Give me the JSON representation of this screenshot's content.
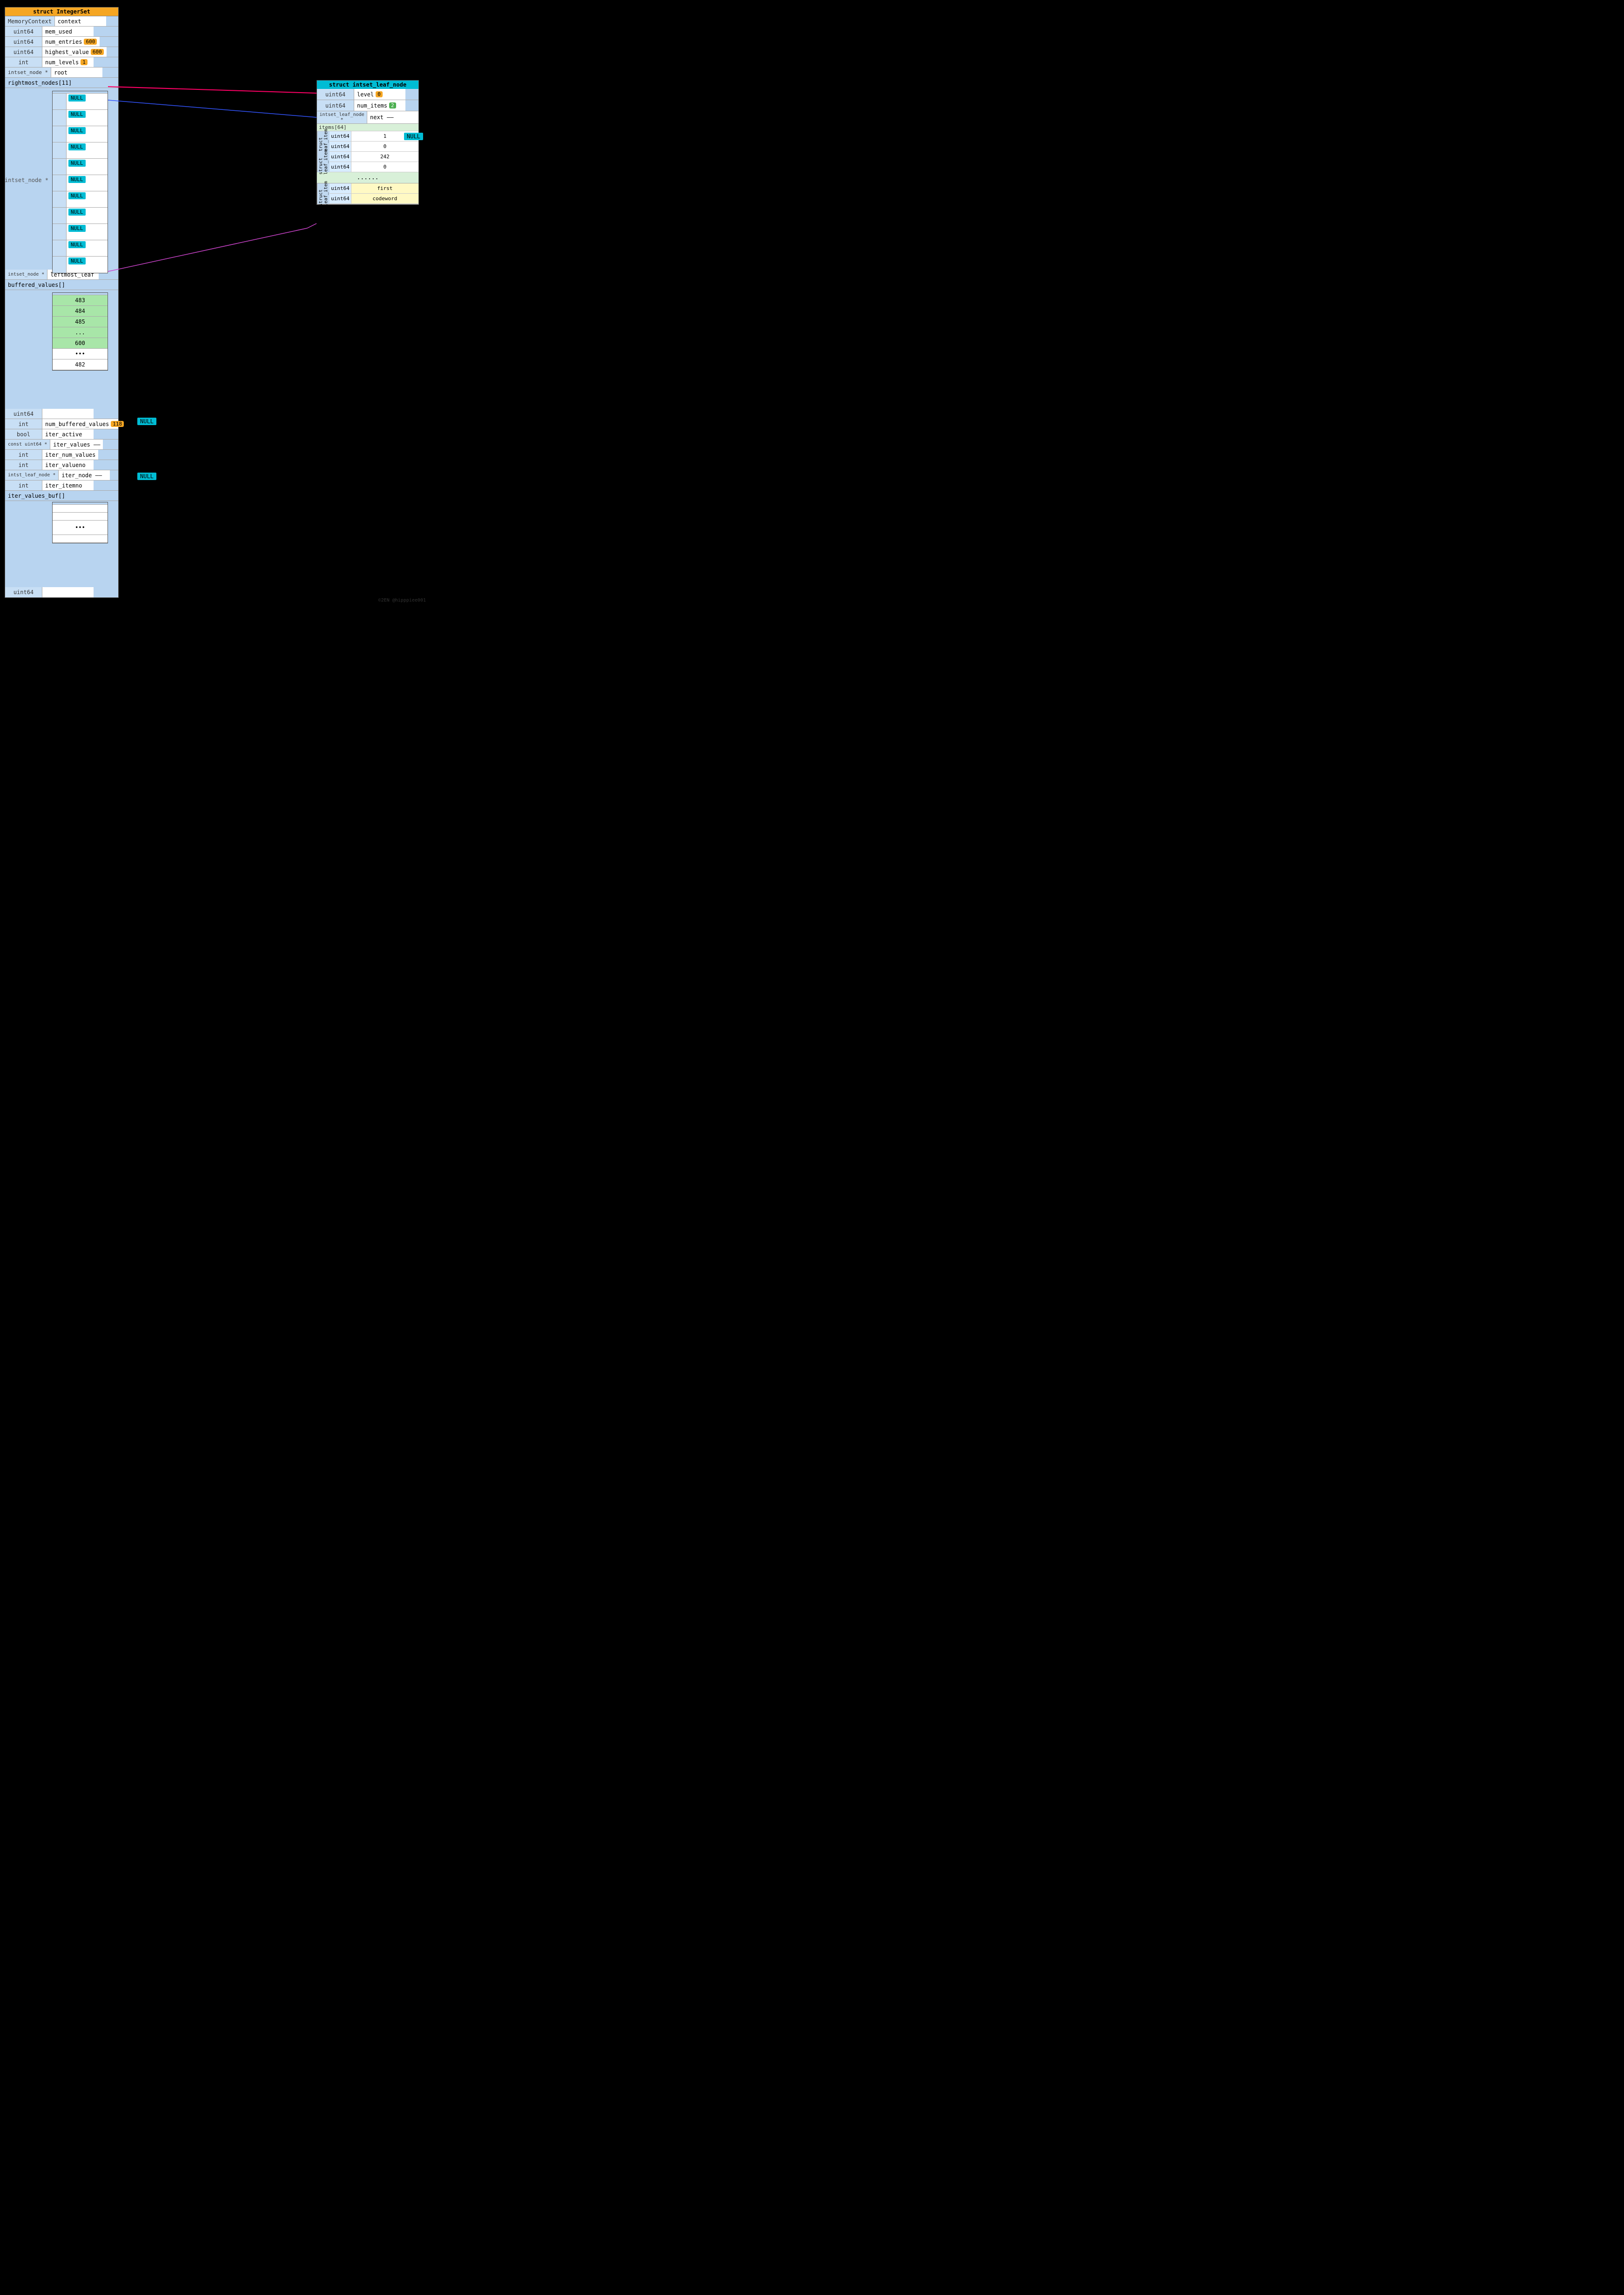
{
  "main_struct": {
    "title": "struct IntegerSet",
    "rows": [
      {
        "type": "MemoryContext",
        "name": "context"
      },
      {
        "type": "uint64",
        "name": "mem_used"
      },
      {
        "type": "uint64",
        "name": "num_entries",
        "badge": "600"
      },
      {
        "type": "uint64",
        "name": "highest_value",
        "badge": "600"
      },
      {
        "type": "int",
        "name": "num_levels",
        "badge": "1"
      },
      {
        "type": "intset_node *",
        "name": "root"
      },
      {
        "type": "",
        "name": "rightmost_nodes[11]"
      },
      {
        "type": "intset_node *",
        "name": "leftmost_leaf"
      },
      {
        "type": "",
        "name": "buffered_values[]"
      },
      {
        "type": "uint64",
        "name": ""
      },
      {
        "type": "int",
        "name": "num_buffered_values",
        "badge": "118"
      },
      {
        "type": "bool",
        "name": "iter_active"
      },
      {
        "type": "const uint64 *",
        "name": "iter_values"
      },
      {
        "type": "int",
        "name": "iter_num_values"
      },
      {
        "type": "int",
        "name": "iter_valueno"
      },
      {
        "type": "intst_leaf_node *",
        "name": "iter_node"
      },
      {
        "type": "int",
        "name": "iter_itemno"
      },
      {
        "type": "",
        "name": "iter_values_buf[]"
      },
      {
        "type": "uint64",
        "name": ""
      }
    ]
  },
  "rightmost_nodes": {
    "header": "rightmost_nodes[11]",
    "null_items": [
      "NULL",
      "NULL",
      "NULL",
      "NULL",
      "NULL",
      "NULL",
      "NULL",
      "NULL",
      "NULL",
      "NULL"
    ],
    "last_null": "NULL"
  },
  "buffered_values": {
    "header": "buffered_values[]",
    "items": [
      "483",
      "484",
      "485",
      "...",
      "600"
    ],
    "dots": "•••",
    "last_item": "482"
  },
  "leaf_struct": {
    "title": "struct intset_leaf_node",
    "rows": [
      {
        "type": "uint64",
        "name": "level",
        "badge": "0",
        "badge_color": "orange"
      },
      {
        "type": "uint64",
        "name": "num_items",
        "badge": "2",
        "badge_color": "green"
      },
      {
        "type": "intset_leaf_node *",
        "name": "next"
      }
    ],
    "items_header": "items[64]",
    "item_groups": [
      {
        "label": "struct leaf_item",
        "rows": [
          {
            "type": "uint64",
            "val": "1"
          },
          {
            "type": "uint64",
            "val": "0"
          }
        ]
      },
      {
        "label": "struct leaf_item",
        "rows": [
          {
            "type": "uint64",
            "val": "242"
          },
          {
            "type": "uint64",
            "val": "0"
          }
        ]
      }
    ],
    "dots": "......",
    "last_group": {
      "label": "struct leaf_item",
      "rows": [
        {
          "type": "uint64",
          "val": "first"
        },
        {
          "type": "uint64",
          "val": "codeword"
        }
      ]
    }
  },
  "null_labels": {
    "root_null": "NULL (implied via line)",
    "iter_values_null": "NULL",
    "iter_node_null": "NULL",
    "right_of_next": "NULL"
  },
  "num_badge": "118",
  "watermark": "©2EN @hipppiee001"
}
